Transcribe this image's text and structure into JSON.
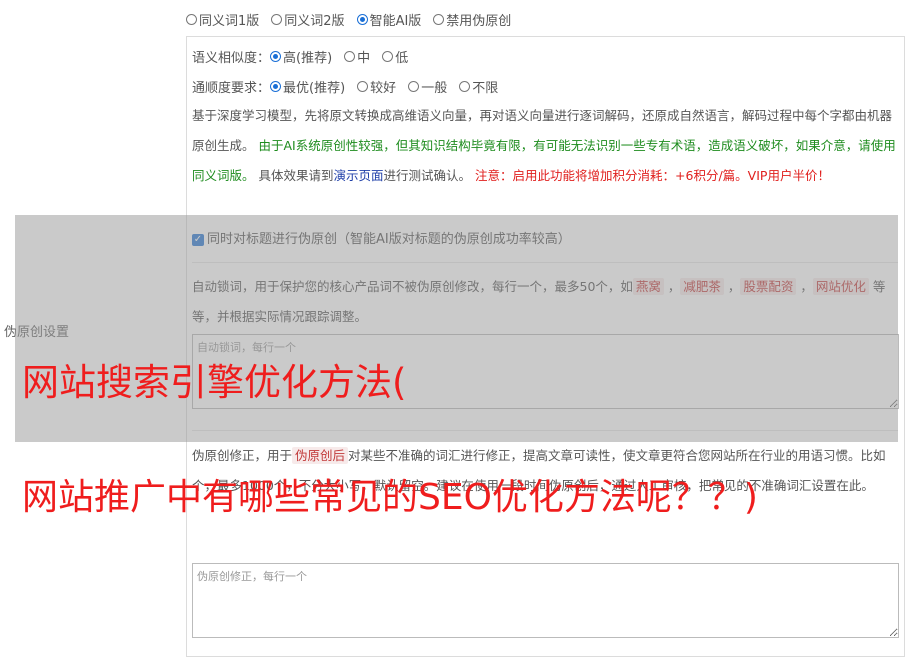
{
  "modes": [
    {
      "label": "同义词1版",
      "selected": false
    },
    {
      "label": "同义词2版",
      "selected": false
    },
    {
      "label": "智能AI版",
      "selected": true
    },
    {
      "label": "禁用伪原创",
      "selected": false
    }
  ],
  "similarity": {
    "label": "语义相似度：",
    "options": [
      {
        "label": "高(推荐)",
        "selected": true
      },
      {
        "label": "中",
        "selected": false
      },
      {
        "label": "低",
        "selected": false
      }
    ]
  },
  "fluency": {
    "label": "通顺度要求：",
    "options": [
      {
        "label": "最优(推荐)",
        "selected": true
      },
      {
        "label": "较好",
        "selected": false
      },
      {
        "label": "一般",
        "selected": false
      },
      {
        "label": "不限",
        "selected": false
      }
    ]
  },
  "description": {
    "part1": "基于深度学习模型，先将原文转换成高维语义向量，再对语义向量进行逐词解码，还原成自然语言，解码过程中每个字都由机器原创生成。",
    "part2": "由于AI系统原创性较强，但其知识结构毕竟有限，有可能无法识别一些专有术语，造成语义破坏，如果介意，请使用同义词版。",
    "part3": "具体效果请到",
    "link": "演示页面",
    "part4": "进行测试确认。",
    "warning": "注意：启用此功能将增加积分消耗：+6积分/篇。VIP用户半价！"
  },
  "side_label": "伪原创设置",
  "title_checkbox": {
    "label": "同时对标题进行伪原创（智能AI版对标题的伪原创成功率较高）",
    "checked": true
  },
  "lock_words": {
    "intro": "自动锁词，用于保护您的核心产品词不被伪原创修改，每行一个，最多50个，如",
    "examples": [
      "燕窝",
      "减肥茶",
      "股票配资",
      "网站优化"
    ],
    "outro": "等等，并根据实际情况跟踪调整。",
    "placeholder": "自动锁词，每行一个"
  },
  "correction": {
    "intro": "伪原创修正，用于",
    "tag": "伪原创后",
    "text1": "对某些不准确的词汇进行修正，提高文章可读性，使文章更符合您网站所在行业的用语习惯。比如",
    "text2": "个，最多1000个，不分大小写，默认留空。建议在使用一段时间伪原创后，通过人工审核，把常见的不准确词汇设置在此。",
    "placeholder": "伪原创修正，每行一个"
  },
  "overlay_title": {
    "line1": "网站搜索引擎优化方法(",
    "line2": "网站推广中有哪些常见的SEO优化方法呢？？)"
  },
  "colors": {
    "accent": "#1a6fd6",
    "green": "#1e8c1e",
    "link": "#1f3fa8",
    "warning": "#e0201e",
    "overlay_text": "#ef1d1d"
  }
}
